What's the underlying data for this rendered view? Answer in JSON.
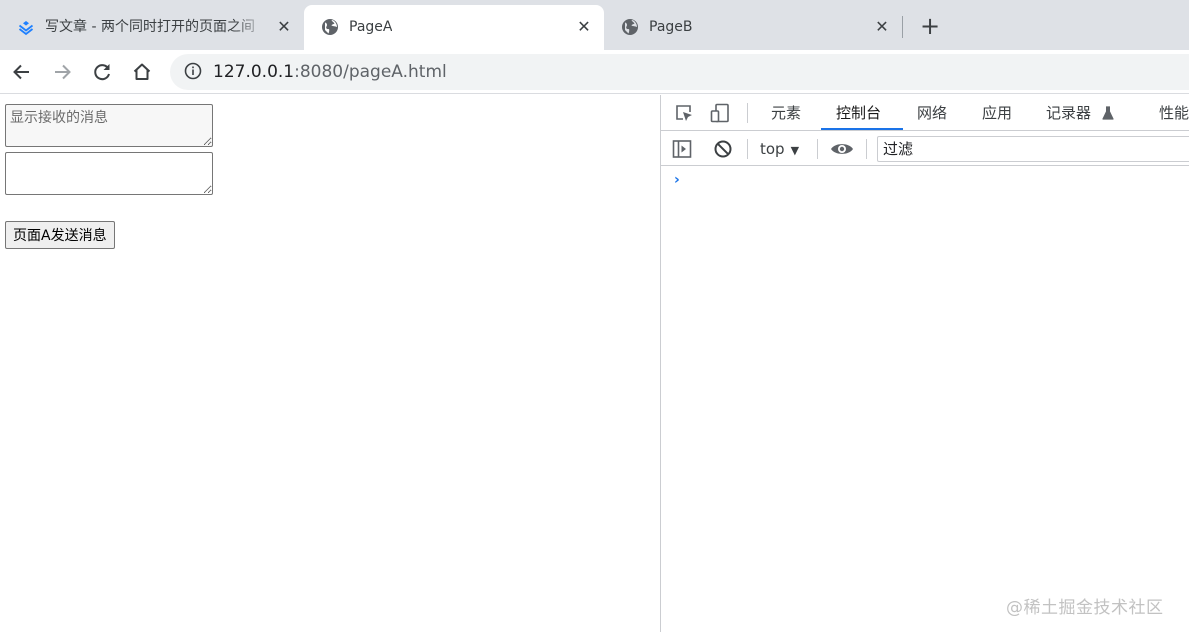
{
  "tabs": [
    {
      "title": "写文章 - 两个同时打开的页面之间"
    },
    {
      "title": "PageA"
    },
    {
      "title": "PageB"
    }
  ],
  "address": {
    "host": "127.0.0.1",
    "rest": ":8080/pageA.html"
  },
  "page": {
    "received_placeholder": "显示接收的消息",
    "input_value": "",
    "send_button": "页面A发送消息"
  },
  "devtools": {
    "tabs": [
      "元素",
      "控制台",
      "网络",
      "应用",
      "记录器",
      "性能"
    ],
    "active_tab": "控制台",
    "context": "top",
    "filter_placeholder": "过滤",
    "prompt": "›"
  },
  "watermark": "@稀土掘金技术社区",
  "colors": {
    "tabstrip": "#dee1e6",
    "accent": "#1a73e8",
    "juejin_blue": "#1e80ff"
  },
  "icons": [
    "juejin-favicon-icon",
    "globe-icon",
    "close-icon",
    "plus-icon",
    "back-icon",
    "forward-icon",
    "reload-icon",
    "home-icon",
    "info-icon",
    "inspect-icon",
    "device-icon",
    "flask-icon",
    "sidebar-icon",
    "clear-icon",
    "eye-icon",
    "dropdown-icon"
  ]
}
